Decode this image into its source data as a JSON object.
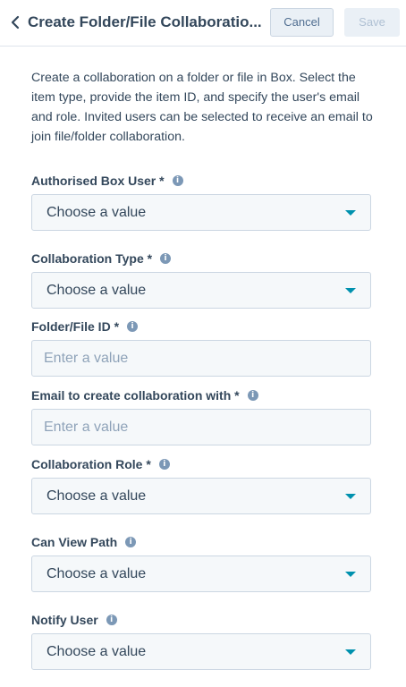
{
  "header": {
    "title": "Create Folder/File Collaboratio...",
    "cancel_label": "Cancel",
    "save_label": "Save",
    "back_icon": "chevron-left-icon"
  },
  "description": "Create a collaboration on a folder or file in Box. Select the item type, provide the item ID, and specify the user's email and role. Invited users can be selected to receive an email to join file/folder collaboration.",
  "info_icon_glyph": "i",
  "fields": [
    {
      "label": "Authorised Box User *",
      "type": "select",
      "value": "Choose a value"
    },
    {
      "label": "Collaboration Type *",
      "type": "select",
      "value": "Choose a value"
    },
    {
      "label": "Folder/File ID *",
      "type": "input",
      "placeholder": "Enter a value"
    },
    {
      "label": "Email to create collaboration with *",
      "type": "input",
      "placeholder": "Enter a value"
    },
    {
      "label": "Collaboration Role *",
      "type": "select",
      "value": "Choose a value"
    },
    {
      "label": "Can View Path",
      "type": "select",
      "value": "Choose a value"
    },
    {
      "label": "Notify User",
      "type": "select",
      "value": "Choose a value"
    }
  ],
  "colors": {
    "text": "#33475b",
    "accent_caret": "#0091ae",
    "field_bg": "#f5f8fa",
    "field_border": "#cbd6e2",
    "info_icon": "#7c98b6"
  }
}
